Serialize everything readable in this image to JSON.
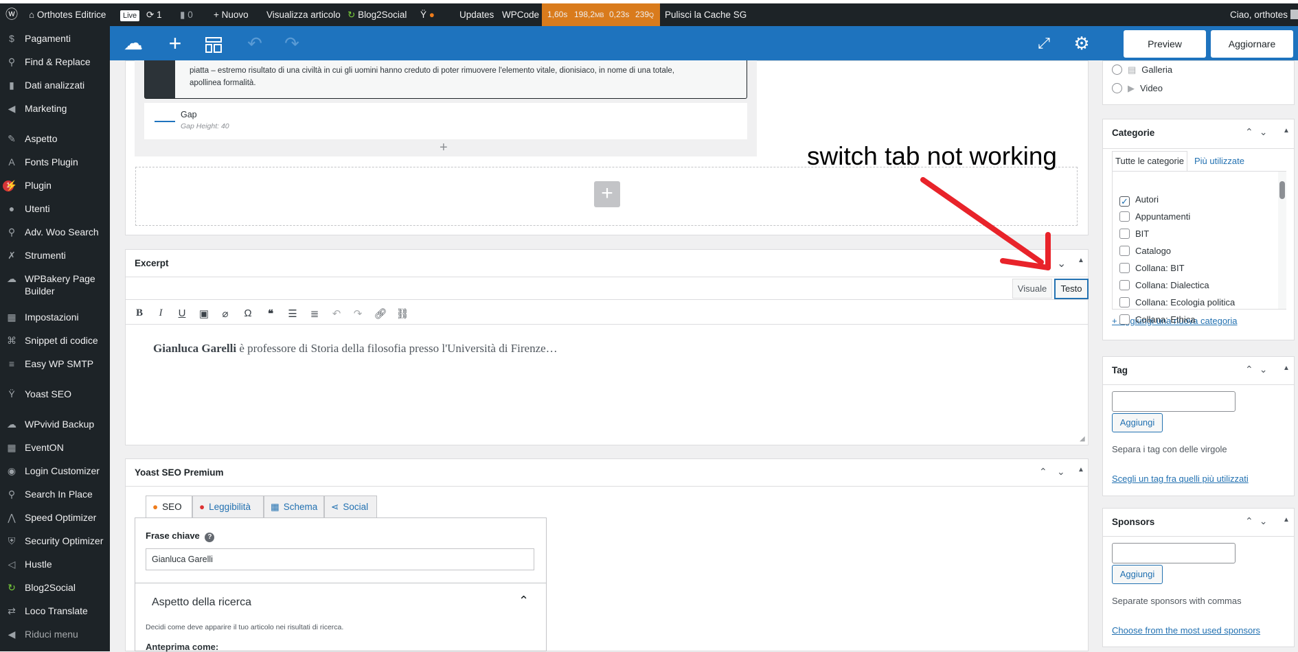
{
  "adminbar": {
    "site": "Orthotes Editrice",
    "live": "Live",
    "updates_count": "1",
    "comments_count": "0",
    "new": "Nuovo",
    "view_post": "Visualizza articolo",
    "blog2social": "Blog2Social",
    "updates": "Updates",
    "wpcode": "WPCode",
    "perf": {
      "time": "1,60s",
      "mem_value": "198,2",
      "mem_unit": "MB",
      "query_time": "0,23s",
      "queries_value": "239",
      "queries_unit": "Q"
    },
    "cache": "Pulisci la Cache SG",
    "greeting": "Ciao, orthotes"
  },
  "sidebar": {
    "items": [
      {
        "label": "Pagamenti",
        "icon": "payments-icon"
      },
      {
        "label": "Find & Replace",
        "icon": "search-icon"
      },
      {
        "label": "Dati analizzati",
        "icon": "bar-chart-icon"
      },
      {
        "label": "Marketing",
        "icon": "megaphone-icon"
      },
      {
        "label": "Aspetto",
        "icon": "paintbrush-icon"
      },
      {
        "label": "Fonts Plugin",
        "icon": "font-icon"
      },
      {
        "label": "Plugin",
        "icon": "plugin-icon",
        "badge": "1"
      },
      {
        "label": "Utenti",
        "icon": "user-icon"
      },
      {
        "label": "Adv. Woo Search",
        "icon": "search-icon"
      },
      {
        "label": "Strumenti",
        "icon": "wrench-icon"
      },
      {
        "label": "WPBakery Page Builder",
        "icon": "cloud-icon"
      },
      {
        "label": "Impostazioni",
        "icon": "settings-icon"
      },
      {
        "label": "Snippet di codice",
        "icon": "code-icon"
      },
      {
        "label": "Easy WP SMTP",
        "icon": "mail-icon"
      },
      {
        "label": "Yoast SEO",
        "icon": "yoast-icon"
      },
      {
        "label": "WPvivid Backup",
        "icon": "cloud-icon"
      },
      {
        "label": "EventON",
        "icon": "calendar-icon"
      },
      {
        "label": "Login Customizer",
        "icon": "login-icon"
      },
      {
        "label": "Search In Place",
        "icon": "search-icon"
      },
      {
        "label": "Speed Optimizer",
        "icon": "speed-icon"
      },
      {
        "label": "Security Optimizer",
        "icon": "shield-icon"
      },
      {
        "label": "Hustle",
        "icon": "hustle-icon"
      },
      {
        "label": "Blog2Social",
        "icon": "blog2social-icon"
      },
      {
        "label": "Loco Translate",
        "icon": "translate-icon"
      },
      {
        "label": "Riduci menu",
        "icon": "collapse-icon"
      }
    ]
  },
  "toolbar": {
    "preview": "Preview",
    "update": "Aggiornare"
  },
  "builder": {
    "quote_line1": "piatta – estremo risultato di una civiltà in cui gli uomini hanno creduto di poter rimuovere l'elemento vitale, dionisiaco, in nome di una totale,",
    "quote_line2": "apollinea formalità.",
    "gap_label": "Gap",
    "gap_height": "Gap Height: 40"
  },
  "excerpt": {
    "title": "Excerpt",
    "tab_visual": "Visuale",
    "tab_text": "Testo",
    "content_bold": "Gianluca Garelli",
    "content_rest": " è professore di Storia della filosofia presso l'Università di Firenze…"
  },
  "annotation": "switch tab not working",
  "yoast": {
    "title": "Yoast SEO Premium",
    "tabs": [
      "SEO",
      "Leggibilità",
      "Schema",
      "Social"
    ],
    "keyphrase_label": "Frase chiave",
    "keyphrase_value": "Gianluca Garelli",
    "search_appearance": "Aspetto della ricerca",
    "search_help": "Decidi come deve apparire il tuo articolo nei risultati di ricerca.",
    "preview_as": "Anteprima come:"
  },
  "format": {
    "gallery": "Galleria",
    "video": "Video"
  },
  "categories": {
    "title": "Categorie",
    "tab_all": "Tutte le categorie",
    "tab_most": "Più utilizzate",
    "items": [
      {
        "label": "Autori",
        "checked": true
      },
      {
        "label": "Appuntamenti",
        "checked": false
      },
      {
        "label": "BIT",
        "checked": false
      },
      {
        "label": "Catalogo",
        "checked": false
      },
      {
        "label": "Collana: BIT",
        "checked": false
      },
      {
        "label": "Collana: Dialectica",
        "checked": false
      },
      {
        "label": "Collana: Ecologia politica",
        "checked": false
      },
      {
        "label": "Collana: Ethica",
        "checked": false
      }
    ],
    "add_new": "+ Aggiungi una nuova categoria"
  },
  "tags": {
    "title": "Tag",
    "add": "Aggiungi",
    "help": "Separa i tag con delle virgole",
    "choose": "Scegli un tag fra quelli più utilizzati"
  },
  "sponsors": {
    "title": "Sponsors",
    "add": "Aggiungi",
    "help": "Separate sponsors with commas",
    "choose": "Choose from the most used sponsors"
  },
  "colors": {
    "adminbar": "#1d2327",
    "toolbar": "#1e73be",
    "perf": "#d97b1c",
    "link": "#2271b1",
    "arrow": "#e8232a"
  }
}
